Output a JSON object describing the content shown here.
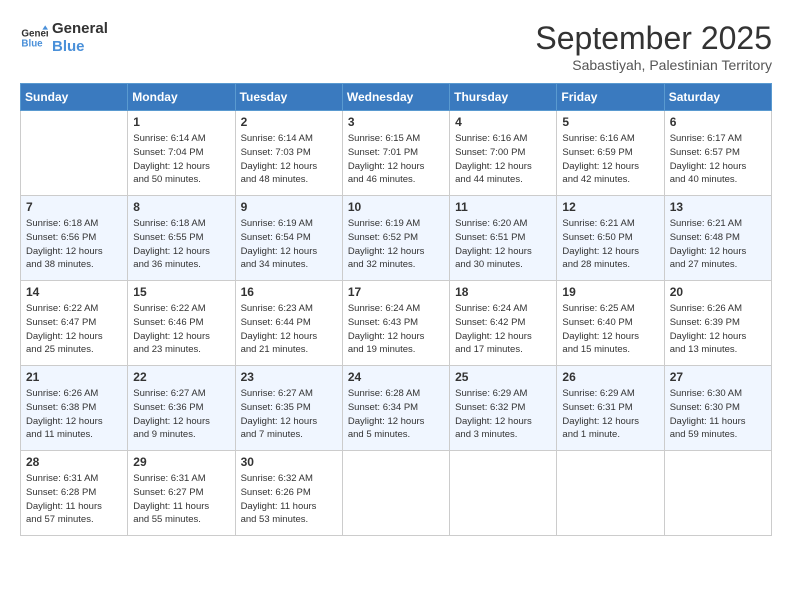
{
  "logo": {
    "line1": "General",
    "line2": "Blue"
  },
  "title": "September 2025",
  "location": "Sabastiyah, Palestinian Territory",
  "days_of_week": [
    "Sunday",
    "Monday",
    "Tuesday",
    "Wednesday",
    "Thursday",
    "Friday",
    "Saturday"
  ],
  "weeks": [
    [
      {
        "day": "",
        "content": ""
      },
      {
        "day": "1",
        "content": "Sunrise: 6:14 AM\nSunset: 7:04 PM\nDaylight: 12 hours\nand 50 minutes."
      },
      {
        "day": "2",
        "content": "Sunrise: 6:14 AM\nSunset: 7:03 PM\nDaylight: 12 hours\nand 48 minutes."
      },
      {
        "day": "3",
        "content": "Sunrise: 6:15 AM\nSunset: 7:01 PM\nDaylight: 12 hours\nand 46 minutes."
      },
      {
        "day": "4",
        "content": "Sunrise: 6:16 AM\nSunset: 7:00 PM\nDaylight: 12 hours\nand 44 minutes."
      },
      {
        "day": "5",
        "content": "Sunrise: 6:16 AM\nSunset: 6:59 PM\nDaylight: 12 hours\nand 42 minutes."
      },
      {
        "day": "6",
        "content": "Sunrise: 6:17 AM\nSunset: 6:57 PM\nDaylight: 12 hours\nand 40 minutes."
      }
    ],
    [
      {
        "day": "7",
        "content": "Sunrise: 6:18 AM\nSunset: 6:56 PM\nDaylight: 12 hours\nand 38 minutes."
      },
      {
        "day": "8",
        "content": "Sunrise: 6:18 AM\nSunset: 6:55 PM\nDaylight: 12 hours\nand 36 minutes."
      },
      {
        "day": "9",
        "content": "Sunrise: 6:19 AM\nSunset: 6:54 PM\nDaylight: 12 hours\nand 34 minutes."
      },
      {
        "day": "10",
        "content": "Sunrise: 6:19 AM\nSunset: 6:52 PM\nDaylight: 12 hours\nand 32 minutes."
      },
      {
        "day": "11",
        "content": "Sunrise: 6:20 AM\nSunset: 6:51 PM\nDaylight: 12 hours\nand 30 minutes."
      },
      {
        "day": "12",
        "content": "Sunrise: 6:21 AM\nSunset: 6:50 PM\nDaylight: 12 hours\nand 28 minutes."
      },
      {
        "day": "13",
        "content": "Sunrise: 6:21 AM\nSunset: 6:48 PM\nDaylight: 12 hours\nand 27 minutes."
      }
    ],
    [
      {
        "day": "14",
        "content": "Sunrise: 6:22 AM\nSunset: 6:47 PM\nDaylight: 12 hours\nand 25 minutes."
      },
      {
        "day": "15",
        "content": "Sunrise: 6:22 AM\nSunset: 6:46 PM\nDaylight: 12 hours\nand 23 minutes."
      },
      {
        "day": "16",
        "content": "Sunrise: 6:23 AM\nSunset: 6:44 PM\nDaylight: 12 hours\nand 21 minutes."
      },
      {
        "day": "17",
        "content": "Sunrise: 6:24 AM\nSunset: 6:43 PM\nDaylight: 12 hours\nand 19 minutes."
      },
      {
        "day": "18",
        "content": "Sunrise: 6:24 AM\nSunset: 6:42 PM\nDaylight: 12 hours\nand 17 minutes."
      },
      {
        "day": "19",
        "content": "Sunrise: 6:25 AM\nSunset: 6:40 PM\nDaylight: 12 hours\nand 15 minutes."
      },
      {
        "day": "20",
        "content": "Sunrise: 6:26 AM\nSunset: 6:39 PM\nDaylight: 12 hours\nand 13 minutes."
      }
    ],
    [
      {
        "day": "21",
        "content": "Sunrise: 6:26 AM\nSunset: 6:38 PM\nDaylight: 12 hours\nand 11 minutes."
      },
      {
        "day": "22",
        "content": "Sunrise: 6:27 AM\nSunset: 6:36 PM\nDaylight: 12 hours\nand 9 minutes."
      },
      {
        "day": "23",
        "content": "Sunrise: 6:27 AM\nSunset: 6:35 PM\nDaylight: 12 hours\nand 7 minutes."
      },
      {
        "day": "24",
        "content": "Sunrise: 6:28 AM\nSunset: 6:34 PM\nDaylight: 12 hours\nand 5 minutes."
      },
      {
        "day": "25",
        "content": "Sunrise: 6:29 AM\nSunset: 6:32 PM\nDaylight: 12 hours\nand 3 minutes."
      },
      {
        "day": "26",
        "content": "Sunrise: 6:29 AM\nSunset: 6:31 PM\nDaylight: 12 hours\nand 1 minute."
      },
      {
        "day": "27",
        "content": "Sunrise: 6:30 AM\nSunset: 6:30 PM\nDaylight: 11 hours\nand 59 minutes."
      }
    ],
    [
      {
        "day": "28",
        "content": "Sunrise: 6:31 AM\nSunset: 6:28 PM\nDaylight: 11 hours\nand 57 minutes."
      },
      {
        "day": "29",
        "content": "Sunrise: 6:31 AM\nSunset: 6:27 PM\nDaylight: 11 hours\nand 55 minutes."
      },
      {
        "day": "30",
        "content": "Sunrise: 6:32 AM\nSunset: 6:26 PM\nDaylight: 11 hours\nand 53 minutes."
      },
      {
        "day": "",
        "content": ""
      },
      {
        "day": "",
        "content": ""
      },
      {
        "day": "",
        "content": ""
      },
      {
        "day": "",
        "content": ""
      }
    ]
  ]
}
